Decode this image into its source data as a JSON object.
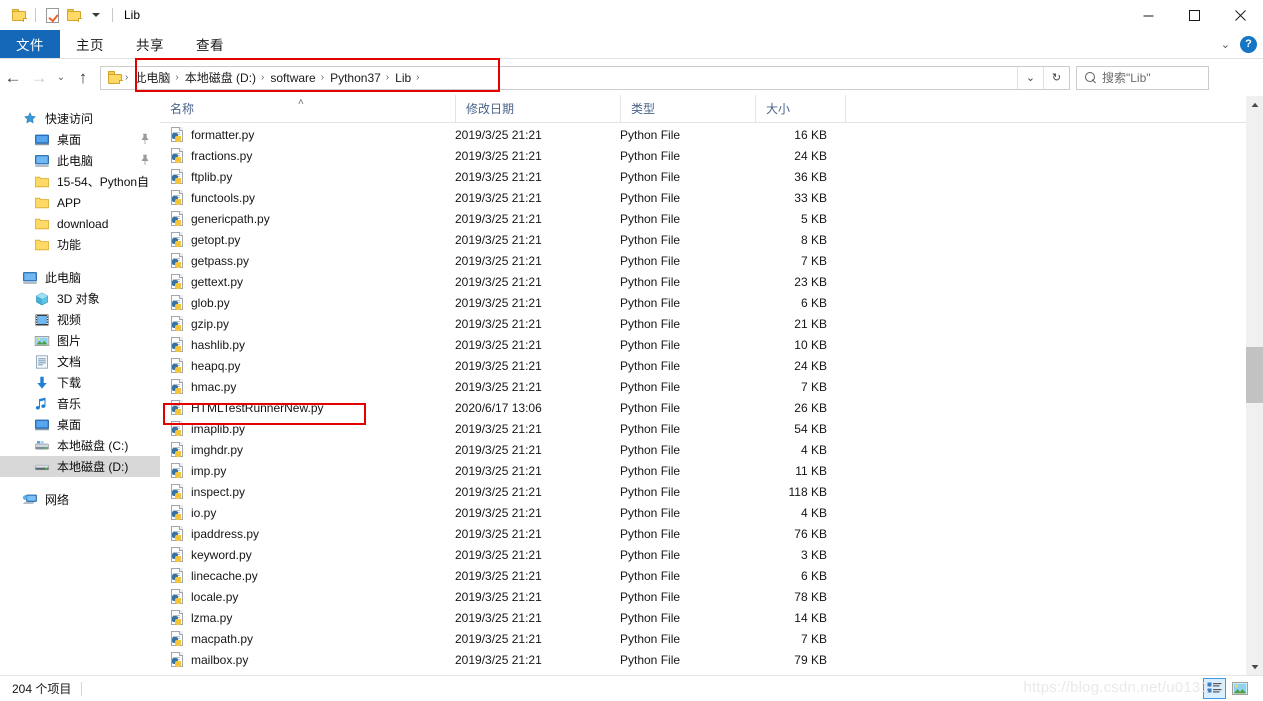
{
  "window": {
    "title": "Lib",
    "quick_access": [
      {
        "name": "folder-icon",
        "label": ""
      },
      {
        "name": "properties-icon",
        "label": ""
      },
      {
        "name": "new-folder-icon",
        "label": ""
      },
      {
        "name": "customize-dropdown-icon",
        "label": ""
      }
    ],
    "controls": {
      "minimize": "—",
      "maximize": "☐",
      "close": "✕"
    }
  },
  "ribbon": {
    "tabs": [
      {
        "label": "文件",
        "active": true
      },
      {
        "label": "主页",
        "active": false
      },
      {
        "label": "共享",
        "active": false
      },
      {
        "label": "查看",
        "active": false
      }
    ],
    "collapse_icon": "⌄",
    "help_label": "?"
  },
  "addressbar": {
    "back_icon": "←",
    "forward_icon": "→",
    "history_icon": "⌄",
    "up_icon": "↑",
    "crumbs": [
      "此电脑",
      "本地磁盘 (D:)",
      "software",
      "Python37",
      "Lib"
    ],
    "separator": "›",
    "dropdown_icon": "⌄",
    "refresh_icon": "↻",
    "search_placeholder": "搜索\"Lib\""
  },
  "sidebar": {
    "groups": [
      {
        "header": {
          "label": "快速访问",
          "icon": "pin-star-icon"
        },
        "items": [
          {
            "label": "桌面",
            "icon": "desktop-icon",
            "pinned": true
          },
          {
            "label": "此电脑",
            "icon": "computer-icon",
            "pinned": true
          },
          {
            "label": "15-54、Python自",
            "icon": "folder-icon",
            "pinned": false
          },
          {
            "label": "APP",
            "icon": "folder-icon",
            "pinned": false
          },
          {
            "label": "download",
            "icon": "folder-icon",
            "pinned": false
          },
          {
            "label": "功能",
            "icon": "folder-icon",
            "pinned": false
          }
        ]
      },
      {
        "header": {
          "label": "此电脑",
          "icon": "computer-icon"
        },
        "items": [
          {
            "label": "3D 对象",
            "icon": "3d-objects-icon",
            "selected": false
          },
          {
            "label": "视频",
            "icon": "videos-icon",
            "selected": false
          },
          {
            "label": "图片",
            "icon": "pictures-icon",
            "selected": false
          },
          {
            "label": "文档",
            "icon": "documents-icon",
            "selected": false
          },
          {
            "label": "下载",
            "icon": "downloads-icon",
            "selected": false
          },
          {
            "label": "音乐",
            "icon": "music-icon",
            "selected": false
          },
          {
            "label": "桌面",
            "icon": "desktop-icon",
            "selected": false
          },
          {
            "label": "本地磁盘 (C:)",
            "icon": "drive-c-icon",
            "selected": false
          },
          {
            "label": "本地磁盘 (D:)",
            "icon": "drive-d-icon",
            "selected": true
          }
        ]
      },
      {
        "header": {
          "label": "网络",
          "icon": "network-icon"
        },
        "items": []
      }
    ]
  },
  "filelist": {
    "columns": [
      {
        "label": "名称",
        "sorted": true,
        "sort_dir": "asc"
      },
      {
        "label": "修改日期",
        "sorted": false
      },
      {
        "label": "类型",
        "sorted": false
      },
      {
        "label": "大小",
        "sorted": false
      }
    ],
    "sort_caret": "˄",
    "rows": [
      {
        "name": "formatter.py",
        "date": "2019/3/25 21:21",
        "type": "Python File",
        "size": "16 KB",
        "icon": "python-file-icon",
        "highlighted": false
      },
      {
        "name": "fractions.py",
        "date": "2019/3/25 21:21",
        "type": "Python File",
        "size": "24 KB",
        "icon": "python-file-icon",
        "highlighted": false
      },
      {
        "name": "ftplib.py",
        "date": "2019/3/25 21:21",
        "type": "Python File",
        "size": "36 KB",
        "icon": "python-file-icon",
        "highlighted": false
      },
      {
        "name": "functools.py",
        "date": "2019/3/25 21:21",
        "type": "Python File",
        "size": "33 KB",
        "icon": "python-file-icon",
        "highlighted": false
      },
      {
        "name": "genericpath.py",
        "date": "2019/3/25 21:21",
        "type": "Python File",
        "size": "5 KB",
        "icon": "python-file-icon",
        "highlighted": false
      },
      {
        "name": "getopt.py",
        "date": "2019/3/25 21:21",
        "type": "Python File",
        "size": "8 KB",
        "icon": "python-file-icon",
        "highlighted": false
      },
      {
        "name": "getpass.py",
        "date": "2019/3/25 21:21",
        "type": "Python File",
        "size": "7 KB",
        "icon": "python-file-icon",
        "highlighted": false
      },
      {
        "name": "gettext.py",
        "date": "2019/3/25 21:21",
        "type": "Python File",
        "size": "23 KB",
        "icon": "python-file-icon",
        "highlighted": false
      },
      {
        "name": "glob.py",
        "date": "2019/3/25 21:21",
        "type": "Python File",
        "size": "6 KB",
        "icon": "python-file-icon",
        "highlighted": false
      },
      {
        "name": "gzip.py",
        "date": "2019/3/25 21:21",
        "type": "Python File",
        "size": "21 KB",
        "icon": "python-file-icon",
        "highlighted": false
      },
      {
        "name": "hashlib.py",
        "date": "2019/3/25 21:21",
        "type": "Python File",
        "size": "10 KB",
        "icon": "python-file-icon",
        "highlighted": false
      },
      {
        "name": "heapq.py",
        "date": "2019/3/25 21:21",
        "type": "Python File",
        "size": "24 KB",
        "icon": "python-file-icon",
        "highlighted": false
      },
      {
        "name": "hmac.py",
        "date": "2019/3/25 21:21",
        "type": "Python File",
        "size": "7 KB",
        "icon": "python-file-icon",
        "highlighted": false
      },
      {
        "name": "HTMLTestRunnerNew.py",
        "date": "2020/6/17 13:06",
        "type": "Python File",
        "size": "26 KB",
        "icon": "python-file-icon",
        "highlighted": true
      },
      {
        "name": "imaplib.py",
        "date": "2019/3/25 21:21",
        "type": "Python File",
        "size": "54 KB",
        "icon": "python-file-icon",
        "highlighted": false
      },
      {
        "name": "imghdr.py",
        "date": "2019/3/25 21:21",
        "type": "Python File",
        "size": "4 KB",
        "icon": "python-file-icon",
        "highlighted": false
      },
      {
        "name": "imp.py",
        "date": "2019/3/25 21:21",
        "type": "Python File",
        "size": "11 KB",
        "icon": "python-file-icon",
        "highlighted": false
      },
      {
        "name": "inspect.py",
        "date": "2019/3/25 21:21",
        "type": "Python File",
        "size": "118 KB",
        "icon": "python-file-icon",
        "highlighted": false
      },
      {
        "name": "io.py",
        "date": "2019/3/25 21:21",
        "type": "Python File",
        "size": "4 KB",
        "icon": "python-file-icon",
        "highlighted": false
      },
      {
        "name": "ipaddress.py",
        "date": "2019/3/25 21:21",
        "type": "Python File",
        "size": "76 KB",
        "icon": "python-file-icon",
        "highlighted": false
      },
      {
        "name": "keyword.py",
        "date": "2019/3/25 21:21",
        "type": "Python File",
        "size": "3 KB",
        "icon": "python-file-icon",
        "highlighted": false
      },
      {
        "name": "linecache.py",
        "date": "2019/3/25 21:21",
        "type": "Python File",
        "size": "6 KB",
        "icon": "python-file-icon",
        "highlighted": false
      },
      {
        "name": "locale.py",
        "date": "2019/3/25 21:21",
        "type": "Python File",
        "size": "78 KB",
        "icon": "python-file-icon",
        "highlighted": false
      },
      {
        "name": "lzma.py",
        "date": "2019/3/25 21:21",
        "type": "Python File",
        "size": "14 KB",
        "icon": "python-file-icon",
        "highlighted": false
      },
      {
        "name": "macpath.py",
        "date": "2019/3/25 21:21",
        "type": "Python File",
        "size": "7 KB",
        "icon": "python-file-icon",
        "highlighted": false
      },
      {
        "name": "mailbox.py",
        "date": "2019/3/25 21:21",
        "type": "Python File",
        "size": "79 KB",
        "icon": "python-file-icon",
        "highlighted": false
      }
    ],
    "scrollbar": {
      "up_icon": "▲",
      "down_icon": "▼"
    }
  },
  "statusbar": {
    "item_count": "204 个项目",
    "view_details_icon": "details-view-icon",
    "view_large_icon": "large-icons-view-icon"
  },
  "watermark": "https://blog.csdn.net/u0131",
  "colors": {
    "accent": "#1567b8",
    "annotation": "#e50000",
    "header_text": "#49648a",
    "selection": "#d8d8d8"
  }
}
